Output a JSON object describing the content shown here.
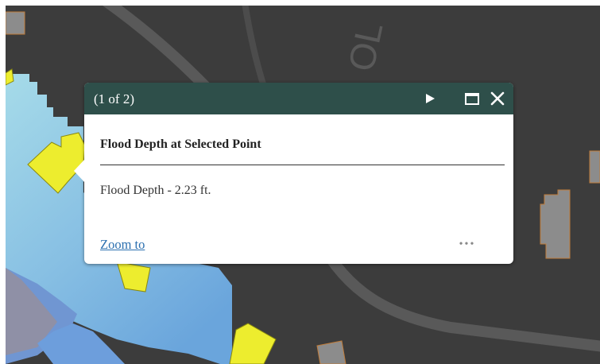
{
  "popup": {
    "page_count": "(1 of 2)",
    "title": "Flood Depth at Selected Point",
    "field_text": "Flood Depth - 2.23 ft.",
    "zoom_label": "Zoom to",
    "more_label": "•••",
    "icons": {
      "next": "play-icon",
      "maximize": "maximize-icon",
      "close": "close-icon"
    }
  },
  "map": {
    "road_label": "OL",
    "colors": {
      "background": "#3c3c3c",
      "road": "#585858",
      "building": "#8d8d8d",
      "selected_building": "#eded2e",
      "flood_light": "#aee2ec",
      "flood_dark": "#6ea7dc",
      "header": "#2e4f4a"
    }
  }
}
